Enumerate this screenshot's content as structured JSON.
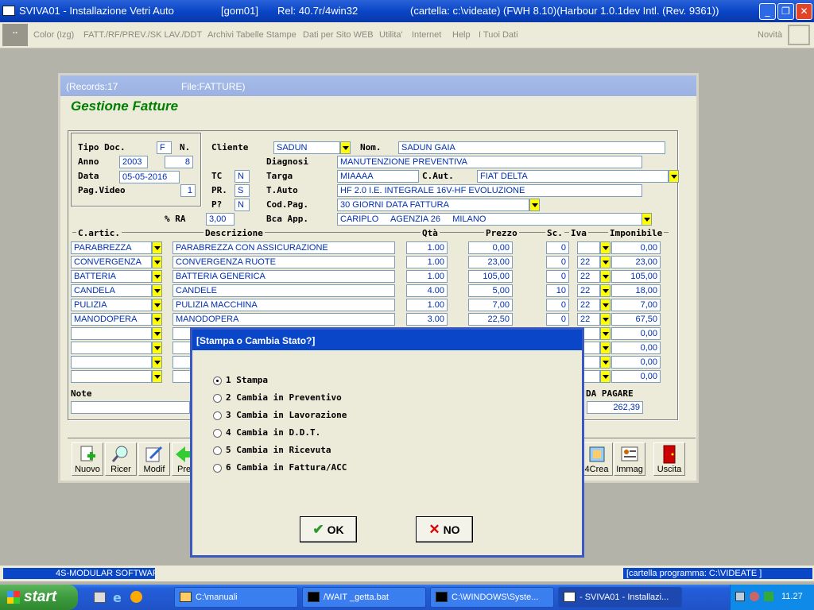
{
  "window": {
    "title": "SVIVA01 - Installazione Vetri Auto",
    "session": "[gom01]",
    "release": "Rel: 40.7r/4win32",
    "folder": "(cartella: c:\\videate) (FWH 8.10)(Harbour 1.0.1dev Intl. (Rev. 9361))",
    "min": "_",
    "max": "❐",
    "close": "✕"
  },
  "menu": {
    "items": [
      "Color (Izg)",
      "FATT./RF/PREV./SK LAV./DDT",
      "Archivi Tabelle Stampe",
      "Dati per Sito WEB",
      "Utilita'",
      "Internet",
      "Help",
      "I Tuoi Dati"
    ],
    "news": "Novità"
  },
  "child": {
    "records": "(Records:17",
    "file": "File:FATTURE)",
    "heading": "Gestione Fatture"
  },
  "header": {
    "tipo_doc_label": "Tipo Doc.",
    "tipo_doc": "F",
    "n_label": "N.",
    "anno_label": "Anno",
    "anno": "2003",
    "numero": "8",
    "data_label": "Data",
    "data": "05-05-2016",
    "pag_video_label": "Pag.Video",
    "pag_video": "1",
    "cliente_label": "Cliente",
    "cliente": "SADUN",
    "nom_label": "Nom.",
    "nom": "SADUN  GAIA",
    "diagnosi_label": "Diagnosi",
    "diagnosi": "MANUTENZIONE PREVENTIVA",
    "tc_label": "TC",
    "tc": "N",
    "targa_label": "Targa",
    "targa": "MIAAAA",
    "caut_label": "C.Aut.",
    "caut": "FIAT DELTA",
    "pr_label": "PR.",
    "pr": "S",
    "tauto_label": "T.Auto",
    "tauto": "HF 2.0 I.E. INTEGRALE 16V-HF EVOLUZIONE",
    "pq_label": "P?",
    "pq": "N",
    "codpag_label": "Cod.Pag.",
    "codpag": "30 GIORNI DATA FATTURA",
    "ra_label": "% RA",
    "ra": "3,00",
    "bca_label": "Bca App.",
    "bca": "CARIPLO     AGENZIA 26     MILANO"
  },
  "grid": {
    "columns": [
      "C.artic.",
      "Descrizione",
      "Qtà",
      "Prezzo",
      "Sc.",
      "Iva",
      "Imponibile"
    ],
    "rows": [
      {
        "code": "PARABREZZA",
        "desc": "PARABREZZA  CON ASSICURAZIONE",
        "qty": "1.00",
        "price": "0,00",
        "sc": "0",
        "iva": "",
        "imp": "0,00"
      },
      {
        "code": "CONVERGENZA",
        "desc": "CONVERGENZA RUOTE",
        "qty": "1.00",
        "price": "23,00",
        "sc": "0",
        "iva": "22",
        "imp": "23,00"
      },
      {
        "code": "BATTERIA",
        "desc": "BATTERIA GENERICA",
        "qty": "1.00",
        "price": "105,00",
        "sc": "0",
        "iva": "22",
        "imp": "105,00"
      },
      {
        "code": "CANDELA",
        "desc": "CANDELE",
        "qty": "4.00",
        "price": "5,00",
        "sc": "10",
        "iva": "22",
        "imp": "18,00"
      },
      {
        "code": "PULIZIA",
        "desc": "PULIZIA MACCHINA",
        "qty": "1.00",
        "price": "7,00",
        "sc": "0",
        "iva": "22",
        "imp": "7,00"
      },
      {
        "code": "MANODOPERA",
        "desc": "MANODOPERA",
        "qty": "3.00",
        "price": "22,50",
        "sc": "0",
        "iva": "22",
        "imp": "67,50"
      },
      {
        "code": "",
        "desc": "",
        "qty": "",
        "price": "",
        "sc": "",
        "iva": "",
        "imp": "0,00"
      },
      {
        "code": "",
        "desc": "",
        "qty": "",
        "price": "",
        "sc": "",
        "iva": "",
        "imp": "0,00"
      },
      {
        "code": "",
        "desc": "",
        "qty": "",
        "price": "",
        "sc": "",
        "iva": "",
        "imp": "0,00"
      },
      {
        "code": "",
        "desc": "",
        "qty": "",
        "price": "",
        "sc": "",
        "iva": "",
        "imp": "0,00"
      }
    ]
  },
  "footer": {
    "note_label": "Note",
    "note": "",
    "da_pagare_label": "DA PAGARE",
    "da_pagare": "262,39"
  },
  "toolbar": [
    {
      "label": "Nuovo",
      "icon": "new-document-icon"
    },
    {
      "label": "Ricer",
      "icon": "magnifier-icon"
    },
    {
      "label": "Modif",
      "icon": "edit-icon"
    },
    {
      "label": "Pre",
      "icon": "previous-arrow-icon"
    },
    {
      "label": "4Crea",
      "icon": "create-icon"
    },
    {
      "label": "Immag",
      "icon": "image-icon"
    },
    {
      "label": "Uscita",
      "icon": "exit-door-icon"
    }
  ],
  "dialog": {
    "title": "[Stampa o Cambia Stato?]",
    "options": [
      "1 Stampa",
      "2 Cambia in Preventivo",
      "3 Cambia in Lavorazione",
      "4 Cambia in D.D.T.",
      "5 Cambia in Ricevuta",
      "6 Cambia in Fattura/ACC"
    ],
    "selected": 0,
    "ok": "OK",
    "no": "NO"
  },
  "status": {
    "left": "4S-MODULAR SOFTWAR",
    "right": "[cartella programma: C:\\VIDEATE ]"
  },
  "taskbar": {
    "start": "start",
    "tasks": [
      "C:\\manuali",
      "/WAIT _getta.bat",
      "C:\\WINDOWS\\Syste...",
      "- SVIVA01 - Installazi..."
    ],
    "clock": "11.27"
  },
  "colors": {
    "accent": "#0a46c8",
    "heading": "#008000",
    "field_text": "#0030b0",
    "dropdown": "#ffff00"
  }
}
